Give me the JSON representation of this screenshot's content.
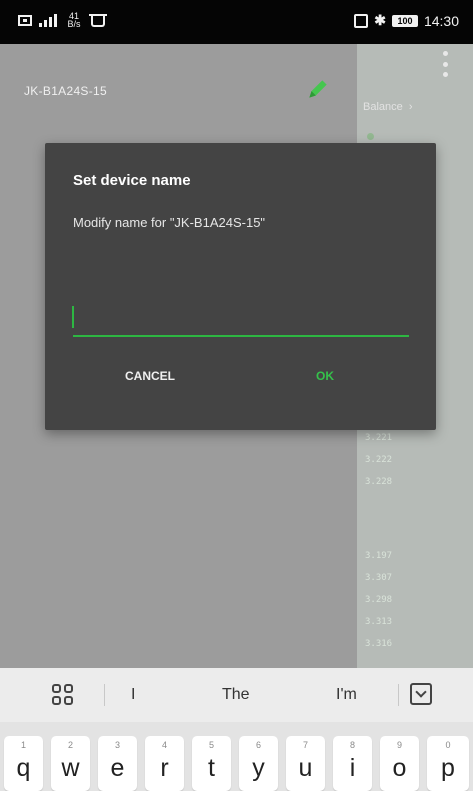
{
  "status_bar": {
    "net_speed_top": "41",
    "net_speed_bottom": "B/s",
    "battery": "100",
    "bluetooth_glyph": "✱",
    "time": "14:30",
    "icons": [
      "sim-icon",
      "signal-icon",
      "notification-icon",
      "nfc-icon",
      "bluetooth-icon",
      "battery-icon"
    ]
  },
  "app": {
    "device_title": "JK-B1A24S-15",
    "balance_label": "Balance",
    "cell_readings": [
      "3.221",
      "3.222",
      "3.228",
      "3.197",
      "3.307",
      "3.298",
      "3.313",
      "3.316"
    ],
    "icons": [
      "pencil-edit-icon",
      "overflow-menu-icon"
    ]
  },
  "dialog": {
    "title": "Set device name",
    "message": "Modify name for \"JK-B1A24S-15\"",
    "input_value": "",
    "input_placeholder": "",
    "cancel_label": "CANCEL",
    "ok_label": "OK",
    "accent_color": "#2db742"
  },
  "keyboard": {
    "suggestions": [
      "I",
      "The",
      "I'm"
    ],
    "keys": [
      {
        "char": "q",
        "hint": "1"
      },
      {
        "char": "w",
        "hint": "2"
      },
      {
        "char": "e",
        "hint": "3"
      },
      {
        "char": "r",
        "hint": "4"
      },
      {
        "char": "t",
        "hint": "5"
      },
      {
        "char": "y",
        "hint": "6"
      },
      {
        "char": "u",
        "hint": "7"
      },
      {
        "char": "i",
        "hint": "8"
      },
      {
        "char": "o",
        "hint": "9"
      },
      {
        "char": "p",
        "hint": "0"
      }
    ],
    "icons": [
      "apps-grid-icon",
      "hide-keyboard-icon"
    ]
  }
}
